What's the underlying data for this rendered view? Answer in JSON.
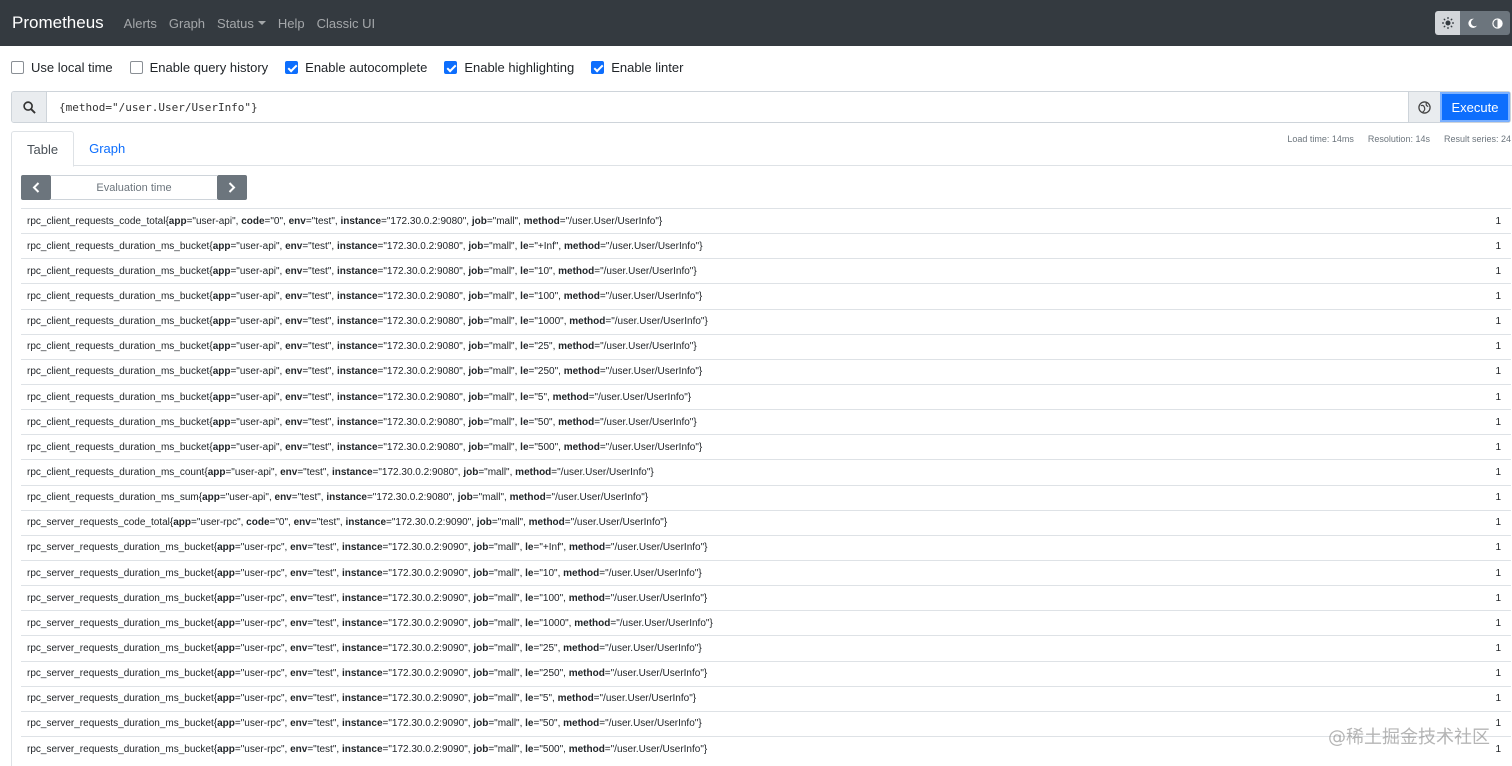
{
  "navbar": {
    "brand": "Prometheus",
    "links": [
      "Alerts",
      "Graph",
      "Status",
      "Help",
      "Classic UI"
    ]
  },
  "options": [
    {
      "label": "Use local time",
      "checked": false
    },
    {
      "label": "Enable query history",
      "checked": false
    },
    {
      "label": "Enable autocomplete",
      "checked": true
    },
    {
      "label": "Enable highlighting",
      "checked": true
    },
    {
      "label": "Enable linter",
      "checked": true
    }
  ],
  "query": {
    "expression": "{method=\"/user.User/UserInfo\"}",
    "execute_label": "Execute"
  },
  "tabs": [
    "Table",
    "Graph"
  ],
  "stats": {
    "load_time": "Load time: 14ms",
    "resolution": "Resolution: 14s",
    "result_series": "Result series: 24"
  },
  "eval": {
    "placeholder": "Evaluation time"
  },
  "results": [
    {
      "metric": "rpc_client_requests_code_total",
      "labels": [
        [
          "app",
          "user-api"
        ],
        [
          "code",
          "0"
        ],
        [
          "env",
          "test"
        ],
        [
          "instance",
          "172.30.0.2:9080"
        ],
        [
          "job",
          "mall"
        ],
        [
          "method",
          "/user.User/UserInfo"
        ]
      ],
      "value": "1"
    },
    {
      "metric": "rpc_client_requests_duration_ms_bucket",
      "labels": [
        [
          "app",
          "user-api"
        ],
        [
          "env",
          "test"
        ],
        [
          "instance",
          "172.30.0.2:9080"
        ],
        [
          "job",
          "mall"
        ],
        [
          "le",
          "+Inf"
        ],
        [
          "method",
          "/user.User/UserInfo"
        ]
      ],
      "value": "1"
    },
    {
      "metric": "rpc_client_requests_duration_ms_bucket",
      "labels": [
        [
          "app",
          "user-api"
        ],
        [
          "env",
          "test"
        ],
        [
          "instance",
          "172.30.0.2:9080"
        ],
        [
          "job",
          "mall"
        ],
        [
          "le",
          "10"
        ],
        [
          "method",
          "/user.User/UserInfo"
        ]
      ],
      "value": "1"
    },
    {
      "metric": "rpc_client_requests_duration_ms_bucket",
      "labels": [
        [
          "app",
          "user-api"
        ],
        [
          "env",
          "test"
        ],
        [
          "instance",
          "172.30.0.2:9080"
        ],
        [
          "job",
          "mall"
        ],
        [
          "le",
          "100"
        ],
        [
          "method",
          "/user.User/UserInfo"
        ]
      ],
      "value": "1"
    },
    {
      "metric": "rpc_client_requests_duration_ms_bucket",
      "labels": [
        [
          "app",
          "user-api"
        ],
        [
          "env",
          "test"
        ],
        [
          "instance",
          "172.30.0.2:9080"
        ],
        [
          "job",
          "mall"
        ],
        [
          "le",
          "1000"
        ],
        [
          "method",
          "/user.User/UserInfo"
        ]
      ],
      "value": "1"
    },
    {
      "metric": "rpc_client_requests_duration_ms_bucket",
      "labels": [
        [
          "app",
          "user-api"
        ],
        [
          "env",
          "test"
        ],
        [
          "instance",
          "172.30.0.2:9080"
        ],
        [
          "job",
          "mall"
        ],
        [
          "le",
          "25"
        ],
        [
          "method",
          "/user.User/UserInfo"
        ]
      ],
      "value": "1"
    },
    {
      "metric": "rpc_client_requests_duration_ms_bucket",
      "labels": [
        [
          "app",
          "user-api"
        ],
        [
          "env",
          "test"
        ],
        [
          "instance",
          "172.30.0.2:9080"
        ],
        [
          "job",
          "mall"
        ],
        [
          "le",
          "250"
        ],
        [
          "method",
          "/user.User/UserInfo"
        ]
      ],
      "value": "1"
    },
    {
      "metric": "rpc_client_requests_duration_ms_bucket",
      "labels": [
        [
          "app",
          "user-api"
        ],
        [
          "env",
          "test"
        ],
        [
          "instance",
          "172.30.0.2:9080"
        ],
        [
          "job",
          "mall"
        ],
        [
          "le",
          "5"
        ],
        [
          "method",
          "/user.User/UserInfo"
        ]
      ],
      "value": "1"
    },
    {
      "metric": "rpc_client_requests_duration_ms_bucket",
      "labels": [
        [
          "app",
          "user-api"
        ],
        [
          "env",
          "test"
        ],
        [
          "instance",
          "172.30.0.2:9080"
        ],
        [
          "job",
          "mall"
        ],
        [
          "le",
          "50"
        ],
        [
          "method",
          "/user.User/UserInfo"
        ]
      ],
      "value": "1"
    },
    {
      "metric": "rpc_client_requests_duration_ms_bucket",
      "labels": [
        [
          "app",
          "user-api"
        ],
        [
          "env",
          "test"
        ],
        [
          "instance",
          "172.30.0.2:9080"
        ],
        [
          "job",
          "mall"
        ],
        [
          "le",
          "500"
        ],
        [
          "method",
          "/user.User/UserInfo"
        ]
      ],
      "value": "1"
    },
    {
      "metric": "rpc_client_requests_duration_ms_count",
      "labels": [
        [
          "app",
          "user-api"
        ],
        [
          "env",
          "test"
        ],
        [
          "instance",
          "172.30.0.2:9080"
        ],
        [
          "job",
          "mall"
        ],
        [
          "method",
          "/user.User/UserInfo"
        ]
      ],
      "value": "1"
    },
    {
      "metric": "rpc_client_requests_duration_ms_sum",
      "labels": [
        [
          "app",
          "user-api"
        ],
        [
          "env",
          "test"
        ],
        [
          "instance",
          "172.30.0.2:9080"
        ],
        [
          "job",
          "mall"
        ],
        [
          "method",
          "/user.User/UserInfo"
        ]
      ],
      "value": "1"
    },
    {
      "metric": "rpc_server_requests_code_total",
      "labels": [
        [
          "app",
          "user-rpc"
        ],
        [
          "code",
          "0"
        ],
        [
          "env",
          "test"
        ],
        [
          "instance",
          "172.30.0.2:9090"
        ],
        [
          "job",
          "mall"
        ],
        [
          "method",
          "/user.User/UserInfo"
        ]
      ],
      "value": "1"
    },
    {
      "metric": "rpc_server_requests_duration_ms_bucket",
      "labels": [
        [
          "app",
          "user-rpc"
        ],
        [
          "env",
          "test"
        ],
        [
          "instance",
          "172.30.0.2:9090"
        ],
        [
          "job",
          "mall"
        ],
        [
          "le",
          "+Inf"
        ],
        [
          "method",
          "/user.User/UserInfo"
        ]
      ],
      "value": "1"
    },
    {
      "metric": "rpc_server_requests_duration_ms_bucket",
      "labels": [
        [
          "app",
          "user-rpc"
        ],
        [
          "env",
          "test"
        ],
        [
          "instance",
          "172.30.0.2:9090"
        ],
        [
          "job",
          "mall"
        ],
        [
          "le",
          "10"
        ],
        [
          "method",
          "/user.User/UserInfo"
        ]
      ],
      "value": "1"
    },
    {
      "metric": "rpc_server_requests_duration_ms_bucket",
      "labels": [
        [
          "app",
          "user-rpc"
        ],
        [
          "env",
          "test"
        ],
        [
          "instance",
          "172.30.0.2:9090"
        ],
        [
          "job",
          "mall"
        ],
        [
          "le",
          "100"
        ],
        [
          "method",
          "/user.User/UserInfo"
        ]
      ],
      "value": "1"
    },
    {
      "metric": "rpc_server_requests_duration_ms_bucket",
      "labels": [
        [
          "app",
          "user-rpc"
        ],
        [
          "env",
          "test"
        ],
        [
          "instance",
          "172.30.0.2:9090"
        ],
        [
          "job",
          "mall"
        ],
        [
          "le",
          "1000"
        ],
        [
          "method",
          "/user.User/UserInfo"
        ]
      ],
      "value": "1"
    },
    {
      "metric": "rpc_server_requests_duration_ms_bucket",
      "labels": [
        [
          "app",
          "user-rpc"
        ],
        [
          "env",
          "test"
        ],
        [
          "instance",
          "172.30.0.2:9090"
        ],
        [
          "job",
          "mall"
        ],
        [
          "le",
          "25"
        ],
        [
          "method",
          "/user.User/UserInfo"
        ]
      ],
      "value": "1"
    },
    {
      "metric": "rpc_server_requests_duration_ms_bucket",
      "labels": [
        [
          "app",
          "user-rpc"
        ],
        [
          "env",
          "test"
        ],
        [
          "instance",
          "172.30.0.2:9090"
        ],
        [
          "job",
          "mall"
        ],
        [
          "le",
          "250"
        ],
        [
          "method",
          "/user.User/UserInfo"
        ]
      ],
      "value": "1"
    },
    {
      "metric": "rpc_server_requests_duration_ms_bucket",
      "labels": [
        [
          "app",
          "user-rpc"
        ],
        [
          "env",
          "test"
        ],
        [
          "instance",
          "172.30.0.2:9090"
        ],
        [
          "job",
          "mall"
        ],
        [
          "le",
          "5"
        ],
        [
          "method",
          "/user.User/UserInfo"
        ]
      ],
      "value": "1"
    },
    {
      "metric": "rpc_server_requests_duration_ms_bucket",
      "labels": [
        [
          "app",
          "user-rpc"
        ],
        [
          "env",
          "test"
        ],
        [
          "instance",
          "172.30.0.2:9090"
        ],
        [
          "job",
          "mall"
        ],
        [
          "le",
          "50"
        ],
        [
          "method",
          "/user.User/UserInfo"
        ]
      ],
      "value": "1"
    },
    {
      "metric": "rpc_server_requests_duration_ms_bucket",
      "labels": [
        [
          "app",
          "user-rpc"
        ],
        [
          "env",
          "test"
        ],
        [
          "instance",
          "172.30.0.2:9090"
        ],
        [
          "job",
          "mall"
        ],
        [
          "le",
          "500"
        ],
        [
          "method",
          "/user.User/UserInfo"
        ]
      ],
      "value": "1"
    }
  ],
  "watermark": "@稀土掘金技术社区"
}
